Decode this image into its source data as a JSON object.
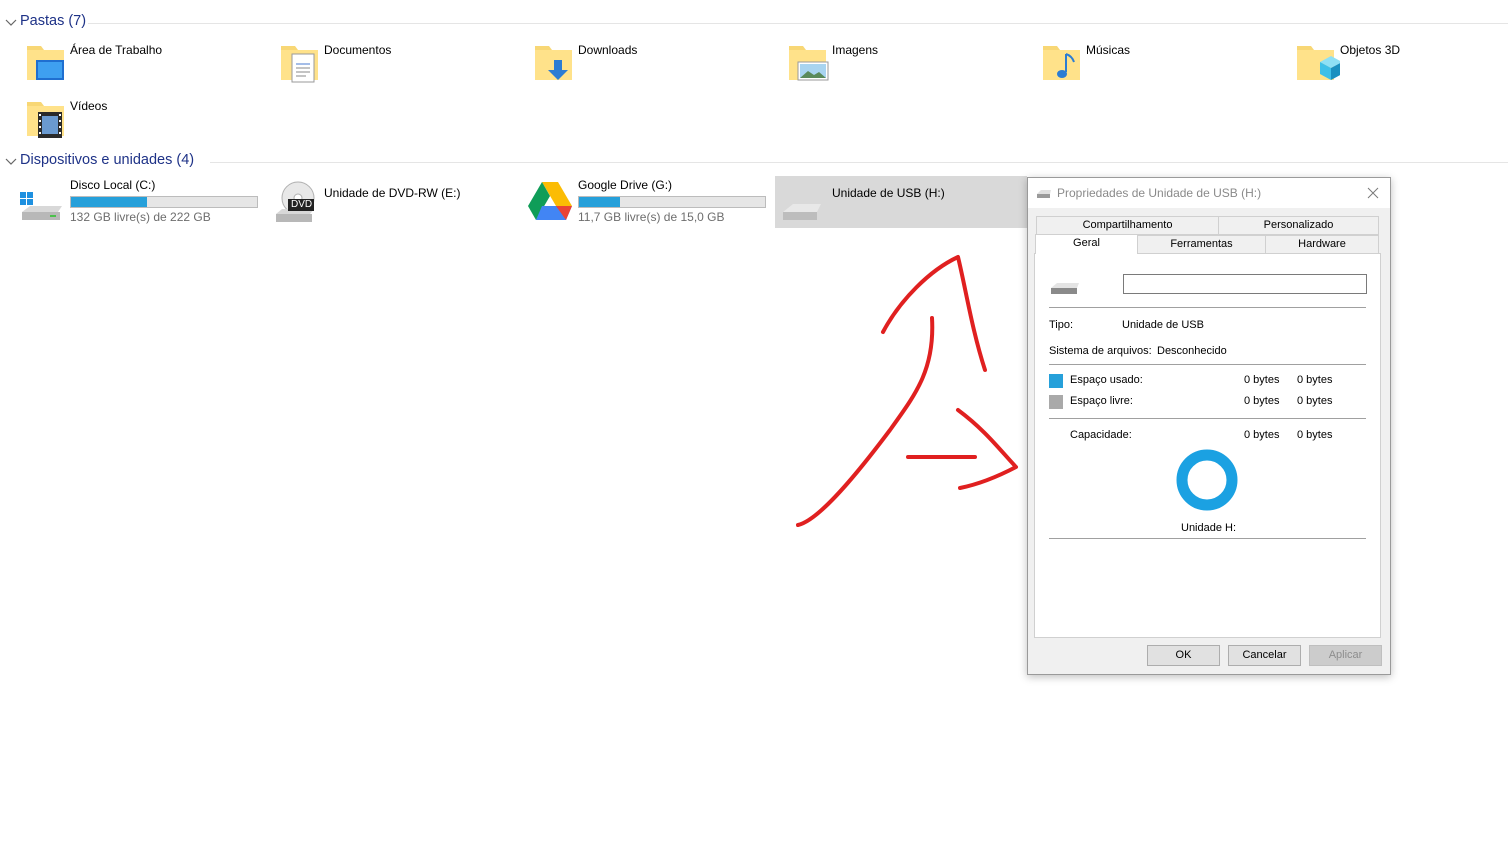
{
  "sections": {
    "folders": {
      "title": "Pastas (7)"
    },
    "devices": {
      "title": "Dispositivos e unidades (4)"
    }
  },
  "folders": [
    {
      "label": "Área de Trabalho",
      "icon": "desktop-folder-icon"
    },
    {
      "label": "Documentos",
      "icon": "documents-folder-icon"
    },
    {
      "label": "Downloads",
      "icon": "downloads-folder-icon"
    },
    {
      "label": "Imagens",
      "icon": "pictures-folder-icon"
    },
    {
      "label": "Músicas",
      "icon": "music-folder-icon"
    },
    {
      "label": "Objetos 3D",
      "icon": "3d-objects-folder-icon"
    },
    {
      "label": "Vídeos",
      "icon": "videos-folder-icon"
    }
  ],
  "drives": [
    {
      "name": "Disco Local (C:)",
      "free": "132 GB livre(s) de 222 GB",
      "used_fraction": 0.41,
      "icon": "windows-drive-icon"
    },
    {
      "name": "Unidade de DVD-RW (E:)",
      "icon": "dvd-drive-icon",
      "badge": "DVD"
    },
    {
      "name": "Google Drive (G:)",
      "free": "11,7 GB livre(s) de 15,0 GB",
      "used_fraction": 0.22,
      "icon": "google-drive-icon"
    },
    {
      "name": "Unidade de USB (H:)",
      "icon": "usb-drive-icon",
      "selected": true
    }
  ],
  "dialog": {
    "title": "Propriedades de Unidade de USB (H:)",
    "tabs_back": [
      "Compartilhamento",
      "Personalizado"
    ],
    "tabs_front": [
      "Geral",
      "Ferramentas",
      "Hardware"
    ],
    "active_tab": "Geral",
    "name_value": "",
    "type_label": "Tipo:",
    "type_value": "Unidade de USB",
    "fs_label": "Sistema de arquivos:",
    "fs_value": "Desconhecido",
    "used_label": "Espaço usado:",
    "used_bytes": "0 bytes",
    "used_bytes2": "0 bytes",
    "free_label": "Espaço livre:",
    "free_bytes": "0 bytes",
    "free_bytes2": "0 bytes",
    "capacity_label": "Capacidade:",
    "capacity_bytes": "0 bytes",
    "capacity_bytes2": "0 bytes",
    "drive_caption": "Unidade H:",
    "buttons": {
      "ok": "OK",
      "cancel": "Cancelar",
      "apply": "Aplicar"
    }
  },
  "colors": {
    "section_title": "#1e3287",
    "bar_fill": "#26a0da",
    "used_swatch": "#26a0da",
    "free_swatch": "#a9a9a9",
    "donut": "#1ba1e2",
    "annotation": "#e02020"
  }
}
